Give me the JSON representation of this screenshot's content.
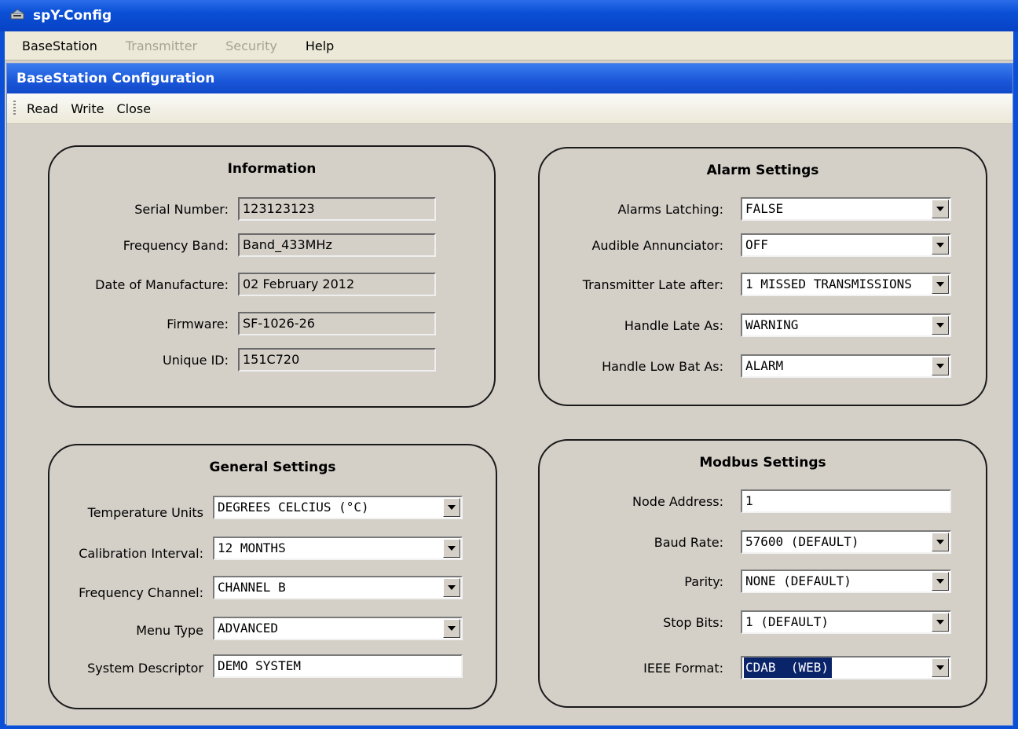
{
  "app": {
    "title": "spY-Config"
  },
  "menu": [
    {
      "label": "BaseStation",
      "enabled": true
    },
    {
      "label": "Transmitter",
      "enabled": false
    },
    {
      "label": "Security",
      "enabled": false
    },
    {
      "label": "Help",
      "enabled": true
    }
  ],
  "child": {
    "title": "BaseStation Configuration"
  },
  "toolbar": {
    "read": "Read",
    "write": "Write",
    "close": "Close"
  },
  "information": {
    "title": "Information",
    "fields": [
      {
        "label": "Serial Number:",
        "value": "123123123"
      },
      {
        "label": "Frequency Band:",
        "value": "Band_433MHz"
      },
      {
        "label": "Date of Manufacture:",
        "value": "02 February 2012"
      },
      {
        "label": "Firmware:",
        "value": "SF-1026-26"
      },
      {
        "label": "Unique ID:",
        "value": "151C720"
      }
    ]
  },
  "alarm": {
    "title": "Alarm Settings",
    "fields": [
      {
        "label": "Alarms Latching:",
        "value": "FALSE"
      },
      {
        "label": "Audible Annunciator:",
        "value": "OFF"
      },
      {
        "label": "Transmitter Late after:",
        "value": "1 MISSED TRANSMISSIONS"
      },
      {
        "label": "Handle Late As:",
        "value": "WARNING"
      },
      {
        "label": "Handle Low Bat As:",
        "value": "ALARM"
      }
    ]
  },
  "general": {
    "title": "General Settings",
    "fields": [
      {
        "label": "Temperature Units",
        "value": "DEGREES CELCIUS (°C)"
      },
      {
        "label": "Calibration Interval:",
        "value": "12 MONTHS"
      },
      {
        "label": "Frequency Channel:",
        "value": "CHANNEL B"
      },
      {
        "label": "Menu Type",
        "value": "ADVANCED"
      },
      {
        "label": "System Descriptor",
        "value": "DEMO SYSTEM"
      }
    ]
  },
  "modbus": {
    "title": "Modbus Settings",
    "fields": [
      {
        "label": "Node Address:",
        "value": "1"
      },
      {
        "label": "Baud Rate:",
        "value": "57600 (DEFAULT)"
      },
      {
        "label": "Parity:",
        "value": "NONE (DEFAULT)"
      },
      {
        "label": "Stop Bits:",
        "value": "1 (DEFAULT)"
      },
      {
        "label": "IEEE  Format:",
        "value": "CDAB  (WEB)"
      }
    ]
  }
}
